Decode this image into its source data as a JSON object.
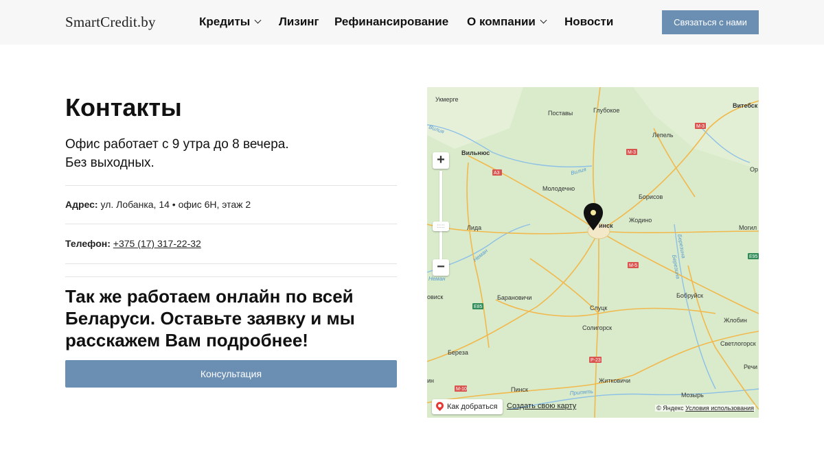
{
  "header": {
    "logo": "SmartCredit.by",
    "nav": [
      {
        "label": "Кредиты",
        "has_dropdown": true
      },
      {
        "label": "Лизинг",
        "has_dropdown": false
      },
      {
        "label": "Рефинансирование",
        "has_dropdown": false
      },
      {
        "label": "О компании",
        "has_dropdown": true
      },
      {
        "label": "Новости",
        "has_dropdown": false
      }
    ],
    "contact_button": "Связаться с нами"
  },
  "main": {
    "title": "Контакты",
    "hours_line1": "Офис работает с 9 утра до 8 вечера.",
    "hours_line2": "Без выходных.",
    "address_label": "Адрес:",
    "address_value": "ул. Лобанка, 14 • офис 6Н, этаж 2",
    "phone_label": "Телефон:",
    "phone_value": "+375 (17) 317-22-32",
    "promo": "Так же работаем онлайн по всей Беларуси. Оставьте заявку и мы расскажем Вам подробнее!",
    "consult_button": "Консультация"
  },
  "map": {
    "zoom_in": "+",
    "zoom_out": "−",
    "zoom_thumb": ":::::",
    "route_button": "Как добраться",
    "create_map_link": "Создать свою карту",
    "copyright": "© Яндекс",
    "terms_link": "Условия использования",
    "cities": [
      "Укмерге",
      "Поставы",
      "Глубокое",
      "Витебск",
      "Лепель",
      "Вильнюс",
      "Молодечно",
      "Борисов",
      "Жодино",
      "Лида",
      "инск",
      "Могил",
      "Барановичи",
      "Бобруйск",
      "Слуцк",
      "Жлобин",
      "Солигорск",
      "Светлогорск",
      "Береза",
      "Речи",
      "Житковичи",
      "Пинск",
      "Мозырь",
      "овиск",
      "Ор",
      "ин"
    ],
    "road_badges": [
      "M-3",
      "M-3",
      "A3",
      "M-5",
      "E85",
      "P-23",
      "M-10",
      "E95"
    ],
    "river_labels": [
      "Вилия",
      "Вилия",
      "Неман",
      "Неман",
      "Березина",
      "Березина",
      "Припять"
    ],
    "colors": {
      "land": "#d9ebcb",
      "roads": "#f2b84b",
      "water": "#8cc0e6",
      "badge_red": "#d9534f",
      "badge_green": "#2e8b57"
    }
  },
  "colors": {
    "accent": "#6b8fb3",
    "header_bg": "#f7f7f7"
  }
}
